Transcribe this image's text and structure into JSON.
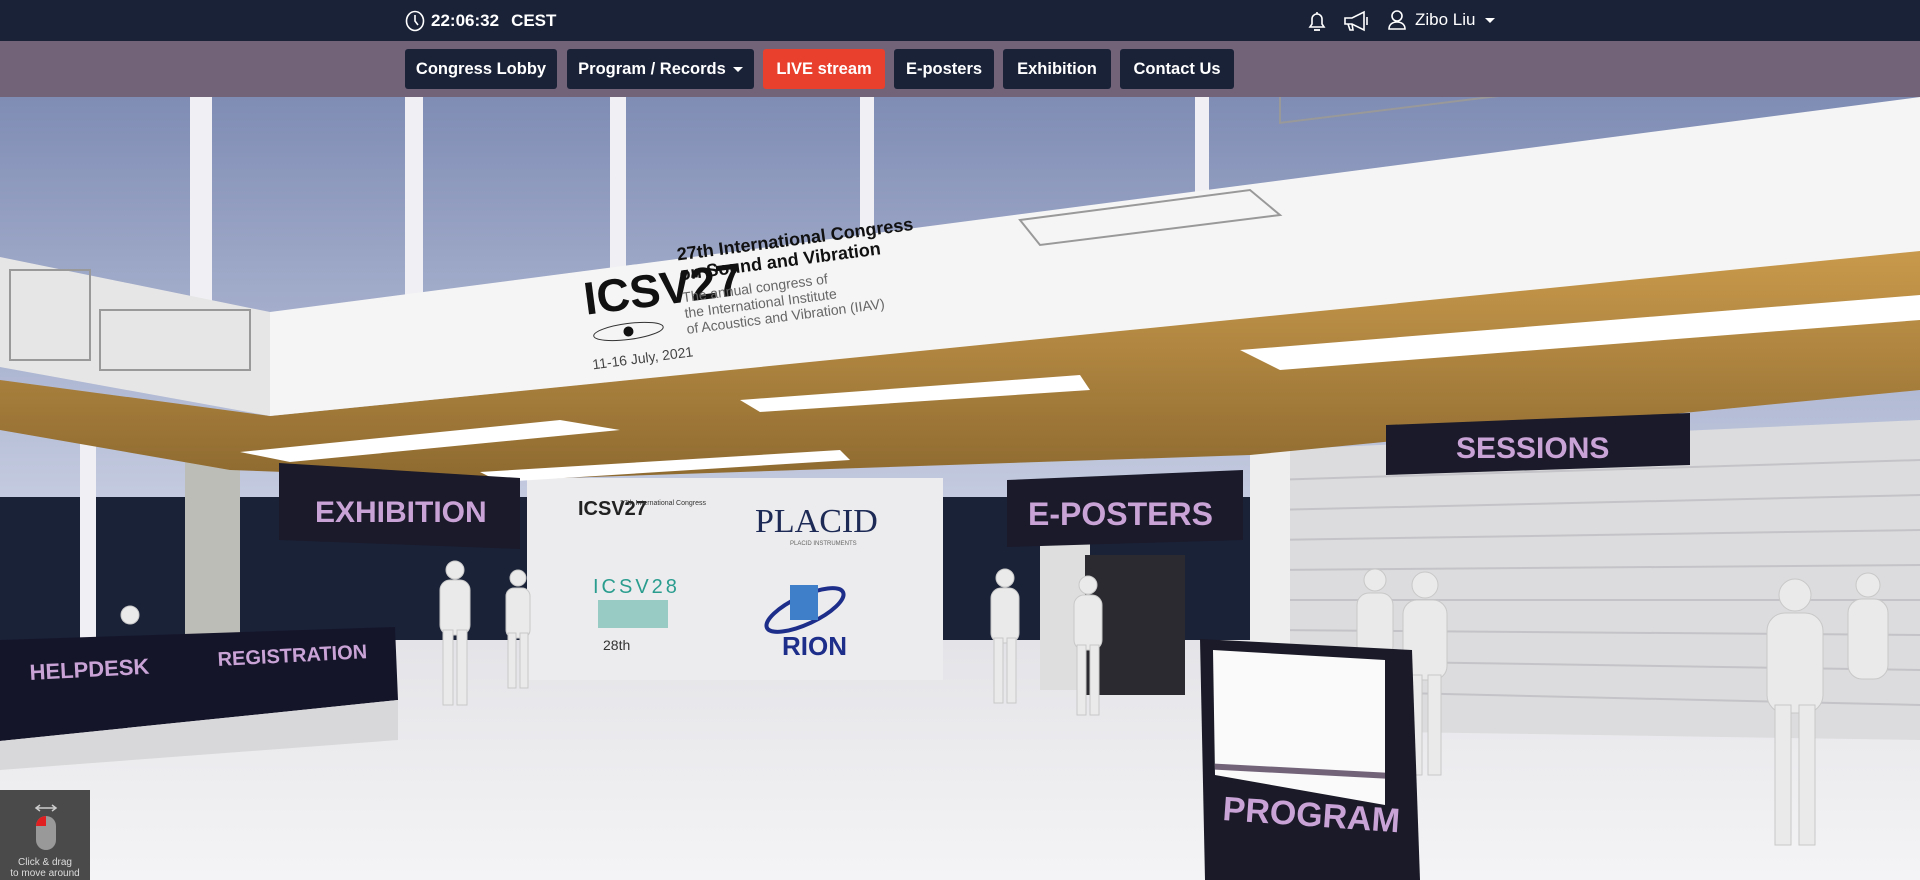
{
  "topbar": {
    "time": "22:06:32",
    "timezone": "CEST",
    "user_name": "Zibo Liu",
    "icons": [
      "clock-icon",
      "bell-icon",
      "megaphone-icon",
      "user-icon"
    ]
  },
  "nav": {
    "items": [
      {
        "label": "Congress Lobby"
      },
      {
        "label": "Program / Records"
      },
      {
        "label": "LIVE stream"
      },
      {
        "label": "E-posters"
      },
      {
        "label": "Exhibition"
      },
      {
        "label": "Contact Us"
      }
    ],
    "live_color": "#e8402d"
  },
  "lobby": {
    "banner": {
      "logo": "ICSV27",
      "title_line1": "27th International Congress",
      "title_line2": "on Sound and Vibration",
      "sub_line1": "The annual congress of",
      "sub_line2": "the International Institute",
      "sub_line3": "of Acoustics and Vibration (IIAV)",
      "dates": "11-16 July, 2021"
    },
    "signs": {
      "exhibition": "EXHIBITION",
      "eposters": "E-POSTERS",
      "sessions": "SESSIONS",
      "helpdesk": "HELPDESK",
      "registration": "REGISTRATION",
      "program": "PROGRAM"
    },
    "sponsors": {
      "placid": "PLACID",
      "placid_sub": "PLACID INSTRUMENTS",
      "rion": "RION",
      "icsv28": "ICSV28",
      "icsv28_sub": "28th"
    },
    "sign_text_color": "#c9a3d6"
  },
  "hint": {
    "line1": "Click & drag",
    "line2": "to move around"
  }
}
